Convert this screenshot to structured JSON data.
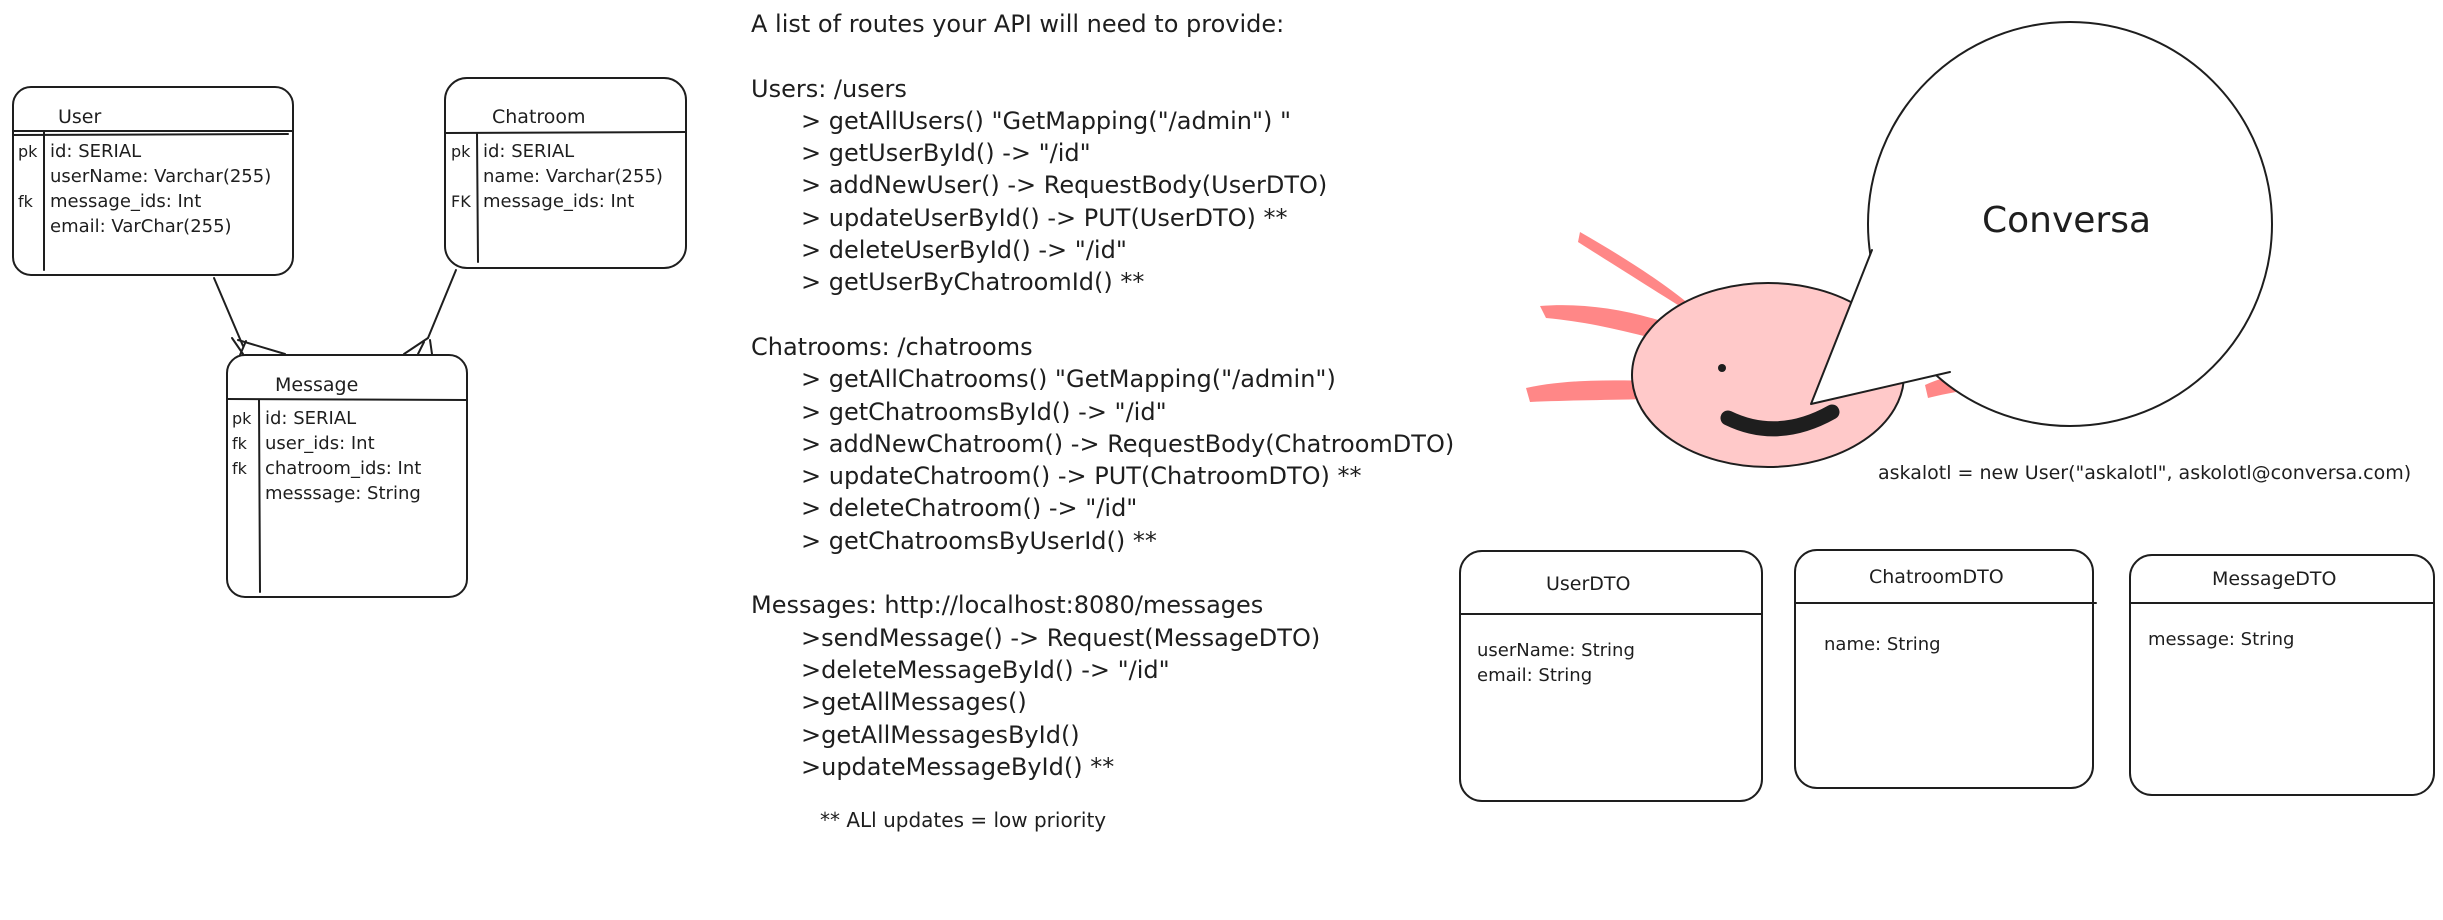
{
  "entities": {
    "user": {
      "title": "User",
      "keys": [
        "pk",
        "",
        "fk",
        ""
      ],
      "fields": [
        "id: SERIAL",
        "userName: Varchar(255)",
        "message_ids: Int",
        "email: VarChar(255)"
      ]
    },
    "chatroom": {
      "title": "Chatroom",
      "keys": [
        "pk",
        "",
        "FK"
      ],
      "fields": [
        "id: SERIAL",
        "name: Varchar(255)",
        "message_ids: Int"
      ]
    },
    "message": {
      "title": "Message",
      "keys": [
        "pk",
        "fk",
        "fk",
        ""
      ],
      "fields": [
        "id: SERIAL",
        "user_ids: Int",
        "chatroom_ids: Int",
        "messsage: String"
      ]
    }
  },
  "routes": {
    "heading": "A list of routes your API will need to provide:",
    "users_header": "Users: /users",
    "users": [
      "> getAllUsers() \"GetMapping(\"/admin\") \"",
      "> getUserById() -> \"/id\"",
      "> addNewUser() -> RequestBody(UserDTO)",
      "> updateUserById() -> PUT(UserDTO) **",
      "> deleteUserById() -> \"/id\"",
      "> getUserByChatroomId() **"
    ],
    "chatrooms_header": "Chatrooms: /chatrooms",
    "chatrooms": [
      "> getAllChatrooms() \"GetMapping(\"/admin\")",
      "> getChatroomsById() -> \"/id\"",
      "> addNewChatroom() -> RequestBody(ChatroomDTO)",
      "> updateChatroom() -> PUT(ChatroomDTO) **",
      "> deleteChatroom() -> \"/id\"",
      "> getChatroomsByUserId() **"
    ],
    "messages_header": "Messages: http://localhost:8080/messages",
    "messages": [
      ">sendMessage() -> Request(MessageDTO)",
      ">deleteMessageById() -> \"/id\"",
      ">getAllMessages()",
      ">getAllMessagesById()",
      ">updateMessageById() **"
    ],
    "footnote": "** ALl updates = low priority"
  },
  "mascot": {
    "brand": "Conversa",
    "caption": "askalotl = new User(\"askalotl\", askolotl@conversa.com)",
    "body_color": "#ffc9c9",
    "gill_color": "#ff8787"
  },
  "dtos": {
    "user": {
      "title": "UserDTO",
      "fields": [
        "userName: String",
        "email: String"
      ]
    },
    "chatroom": {
      "title": "ChatroomDTO",
      "fields": [
        "name: String"
      ]
    },
    "message": {
      "title": "MessageDTO",
      "fields": [
        "message: String"
      ]
    }
  }
}
